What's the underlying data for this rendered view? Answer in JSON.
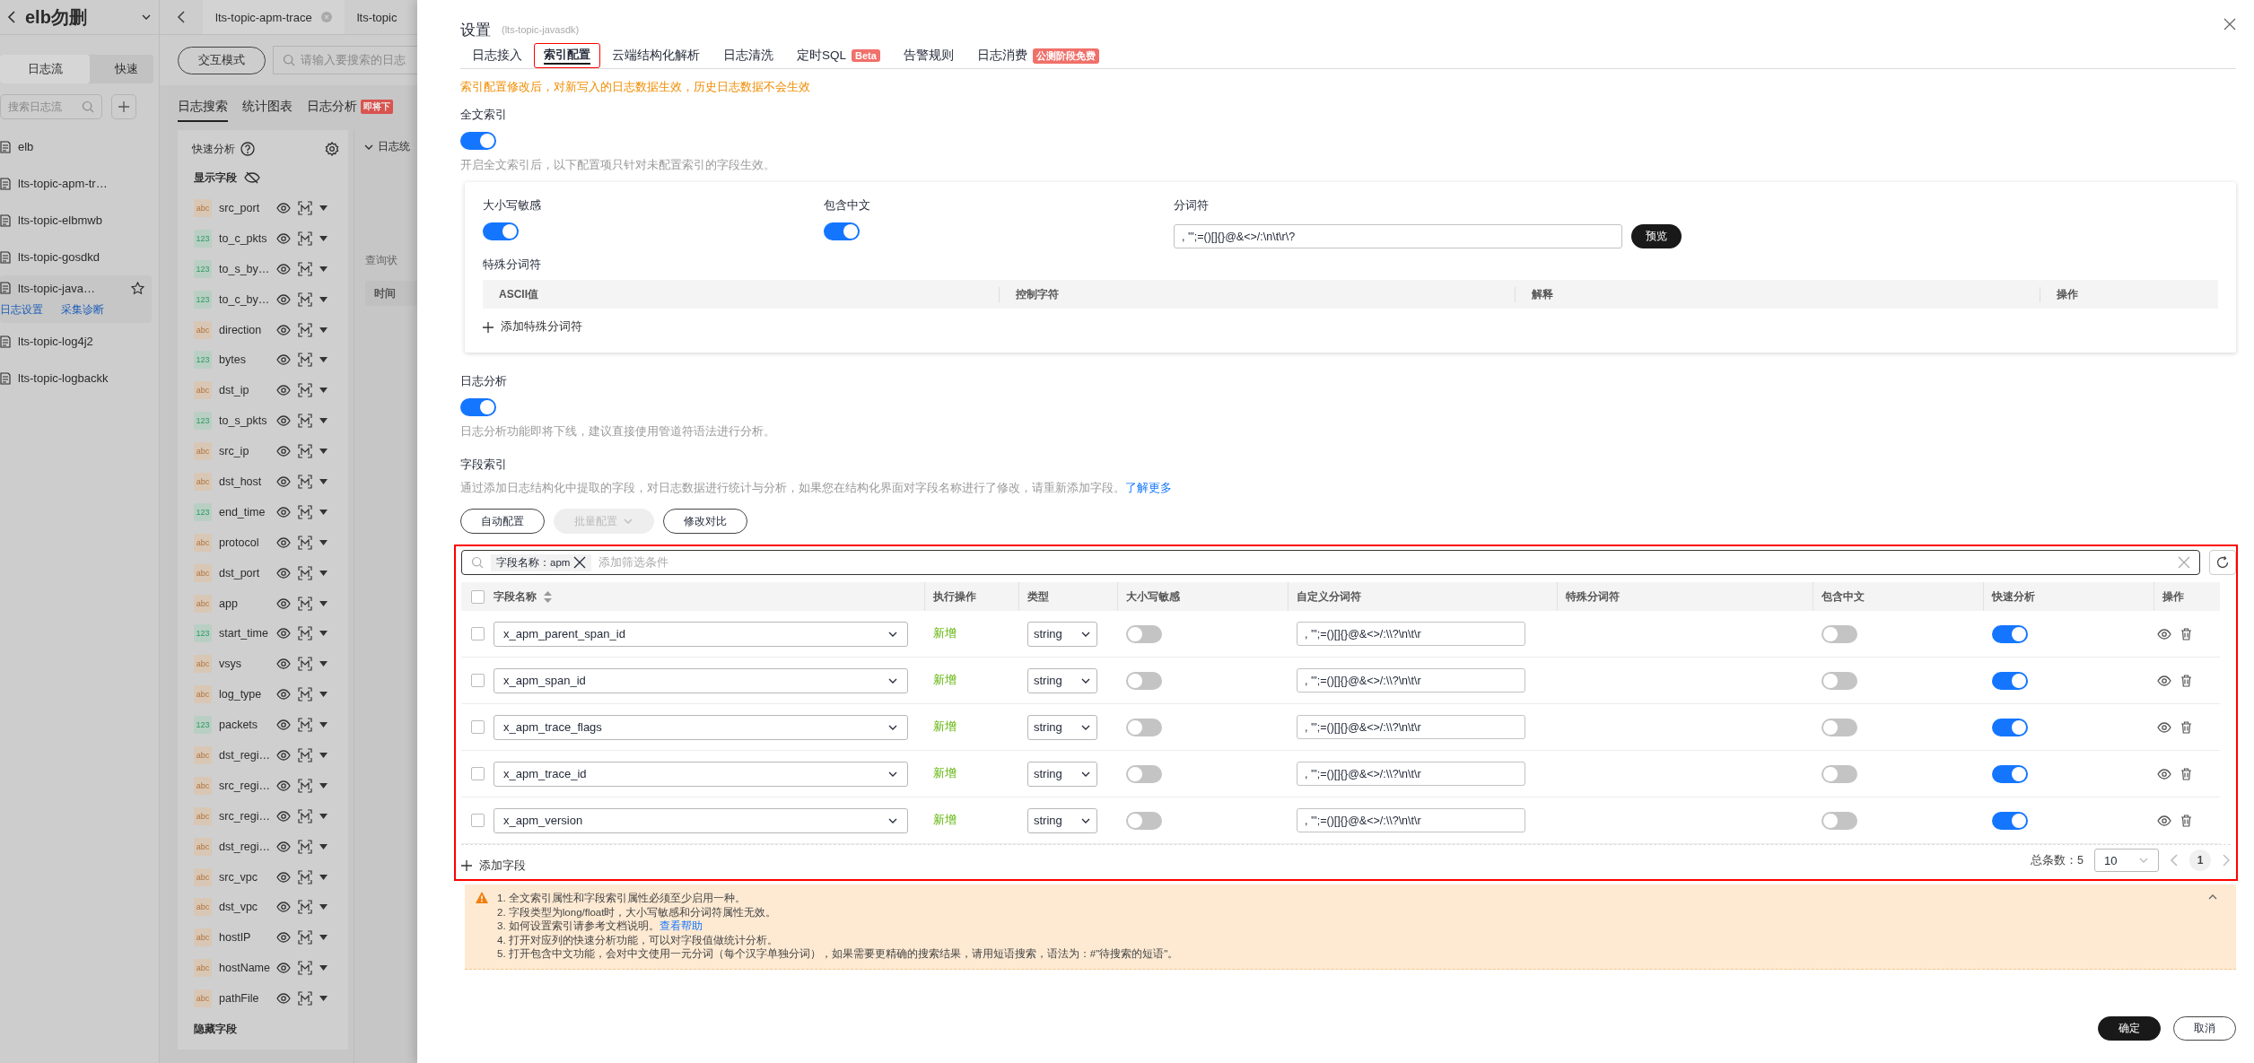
{
  "sidebar": {
    "title": "elb勿删",
    "tabs": [
      {
        "label": "日志流",
        "selected": true
      },
      {
        "label": "快速",
        "selected": false
      }
    ],
    "search_placeholder": "搜索日志流",
    "items": [
      {
        "label": "elb",
        "selected": false
      },
      {
        "label": "lts-topic-apm-tr…",
        "selected": false
      },
      {
        "label": "lts-topic-elbmwb",
        "selected": false
      },
      {
        "label": "lts-topic-gosdkd",
        "selected": false
      },
      {
        "label": "lts-topic-java…",
        "selected": true,
        "links": [
          "日志设置",
          "采集诊断"
        ]
      },
      {
        "label": "lts-topic-log4j2",
        "selected": false
      },
      {
        "label": "lts-topic-logbackk",
        "selected": false
      }
    ]
  },
  "top_tabs": [
    {
      "label": "lts-topic-apm-trace",
      "selected": true
    },
    {
      "label": "lts-topic",
      "selected": false
    }
  ],
  "toolbar": {
    "mode_button": "交互模式",
    "search_placeholder": "请输入要搜索的日志"
  },
  "view_tabs": [
    {
      "label": "日志搜索",
      "selected": true
    },
    {
      "label": "统计图表",
      "selected": false
    },
    {
      "label": "日志分析",
      "selected": false,
      "badge": "即将下"
    }
  ],
  "quick_analysis": {
    "title": "快速分析",
    "shown_heading": "显示字段",
    "hidden_heading": "隐藏字段",
    "fields": [
      {
        "type": "abc",
        "name": "src_port"
      },
      {
        "type": "123",
        "name": "to_c_pkts"
      },
      {
        "type": "123",
        "name": "to_s_by…"
      },
      {
        "type": "123",
        "name": "to_c_by…"
      },
      {
        "type": "abc",
        "name": "direction"
      },
      {
        "type": "123",
        "name": "bytes"
      },
      {
        "type": "abc",
        "name": "dst_ip"
      },
      {
        "type": "123",
        "name": "to_s_pkts"
      },
      {
        "type": "abc",
        "name": "src_ip"
      },
      {
        "type": "abc",
        "name": "dst_host"
      },
      {
        "type": "123",
        "name": "end_time"
      },
      {
        "type": "abc",
        "name": "protocol"
      },
      {
        "type": "abc",
        "name": "dst_port"
      },
      {
        "type": "abc",
        "name": "app"
      },
      {
        "type": "123",
        "name": "start_time"
      },
      {
        "type": "abc",
        "name": "vsys"
      },
      {
        "type": "abc",
        "name": "log_type"
      },
      {
        "type": "123",
        "name": "packets"
      },
      {
        "type": "abc",
        "name": "dst_regi…"
      },
      {
        "type": "abc",
        "name": "src_regi…"
      },
      {
        "type": "abc",
        "name": "src_regi…"
      },
      {
        "type": "abc",
        "name": "dst_regi…"
      },
      {
        "type": "abc",
        "name": "src_vpc"
      },
      {
        "type": "abc",
        "name": "dst_vpc"
      },
      {
        "type": "abc",
        "name": "hostIP"
      },
      {
        "type": "abc",
        "name": "hostName"
      },
      {
        "type": "abc",
        "name": "pathFile"
      }
    ]
  },
  "log_panel": {
    "heading": "日志统",
    "status": "查询状",
    "column": "时间"
  },
  "settings": {
    "title": "设置",
    "subtitle": "(lts-topic-javasdk)",
    "tabs": [
      {
        "label": "日志接入",
        "selected": false,
        "highlighted": false
      },
      {
        "label": "索引配置",
        "selected": true,
        "highlighted": true
      },
      {
        "label": "云端结构化解析",
        "selected": false,
        "highlighted": false
      },
      {
        "label": "日志清洗",
        "selected": false,
        "highlighted": false
      },
      {
        "label": "定时SQL",
        "selected": false,
        "highlighted": false,
        "badge": "Beta"
      },
      {
        "label": "告警规则",
        "selected": false,
        "highlighted": false
      },
      {
        "label": "日志消费",
        "selected": false,
        "highlighted": false,
        "badge": "公测阶段免费"
      }
    ],
    "notice": "索引配置修改后，对新写入的日志数据生效，历史日志数据不会生效",
    "full_text_index": {
      "label": "全文索引",
      "on": true,
      "hint": "开启全文索引后，以下配置项只针对未配置索引的字段生效。",
      "case_sensitive": {
        "label": "大小写敏感",
        "on": true
      },
      "include_chinese": {
        "label": "包含中文",
        "on": true
      },
      "delimiter": {
        "label": "分词符",
        "value": ", '\";=()[]{}@&<>/:\\n\\t\\r\\?",
        "button": "预览"
      },
      "special_delimiters": {
        "label": "特殊分词符",
        "columns": [
          "ASCII值",
          "控制字符",
          "解释",
          "操作"
        ],
        "add": "添加特殊分词符"
      }
    },
    "log_analysis": {
      "label": "日志分析",
      "on": true,
      "hint": "日志分析功能即将下线，建议直接使用管道符语法进行分析。"
    },
    "field_index": {
      "label": "字段索引",
      "description": "通过添加日志结构化中提取的字段，对日志数据进行统计与分析，如果您在结构化界面对字段名称进行了修改，请重新添加字段。",
      "link": "了解更多",
      "buttons": [
        {
          "label": "自动配置",
          "disabled": false,
          "dropdown": false
        },
        {
          "label": "批量配置",
          "disabled": true,
          "dropdown": true
        },
        {
          "label": "修改对比",
          "disabled": false,
          "dropdown": false
        }
      ],
      "highlighted": true,
      "filter": {
        "tag": "字段名称：apm",
        "placeholder": "添加筛选条件"
      },
      "columns": [
        "字段名称",
        "执行操作",
        "类型",
        "大小写敏感",
        "自定义分词符",
        "特殊分词符",
        "包含中文",
        "快速分析",
        "操作"
      ],
      "rows": [
        {
          "checked": false,
          "name": "x_apm_parent_span_id",
          "action": "新增",
          "type": "string",
          "case_sensitive": false,
          "delimiter": ", '\";=()[]{}@&<>/:\\\\?\\n\\t\\r",
          "include_chinese": false,
          "quick_analysis": true
        },
        {
          "checked": false,
          "name": "x_apm_span_id",
          "action": "新增",
          "type": "string",
          "case_sensitive": false,
          "delimiter": ", '\";=()[]{}@&<>/:\\\\?\\n\\t\\r",
          "include_chinese": false,
          "quick_analysis": true
        },
        {
          "checked": false,
          "name": "x_apm_trace_flags",
          "action": "新增",
          "type": "string",
          "case_sensitive": false,
          "delimiter": ", '\";=()[]{}@&<>/:\\\\?\\n\\t\\r",
          "include_chinese": false,
          "quick_analysis": true
        },
        {
          "checked": false,
          "name": "x_apm_trace_id",
          "action": "新增",
          "type": "string",
          "case_sensitive": false,
          "delimiter": ", '\";=()[]{}@&<>/:\\\\?\\n\\t\\r",
          "include_chinese": false,
          "quick_analysis": true
        },
        {
          "checked": false,
          "name": "x_apm_version",
          "action": "新增",
          "type": "string",
          "case_sensitive": false,
          "delimiter": ", '\";=()[]{}@&<>/:\\\\?\\n\\t\\r",
          "include_chinese": false,
          "quick_analysis": true
        }
      ],
      "add": "添加字段",
      "pagination": {
        "total": "总条数：5",
        "page_size": "10",
        "pages": [
          {
            "label": "1",
            "selected": true
          }
        ]
      }
    },
    "tips": [
      {
        "text": "1. 全文索引属性和字段索引属性必须至少启用一种。"
      },
      {
        "text": "2. 字段类型为long/float时，大小写敏感和分词符属性无效。"
      },
      {
        "text": "3. 如何设置索引请参考文档说明。",
        "link": "查看帮助"
      },
      {
        "text": "4. 打开对应列的快速分析功能，可以对字段值做统计分析。"
      },
      {
        "text": "5. 打开包含中文功能，会对中文使用一元分词（每个汉字单独分词），如果需要更精确的搜索结果，请用短语搜索，语法为：#\"待搜索的短语\"。"
      }
    ],
    "footer": [
      {
        "label": "确定",
        "kind": "primary"
      },
      {
        "label": "取消",
        "kind": "default"
      }
    ]
  }
}
